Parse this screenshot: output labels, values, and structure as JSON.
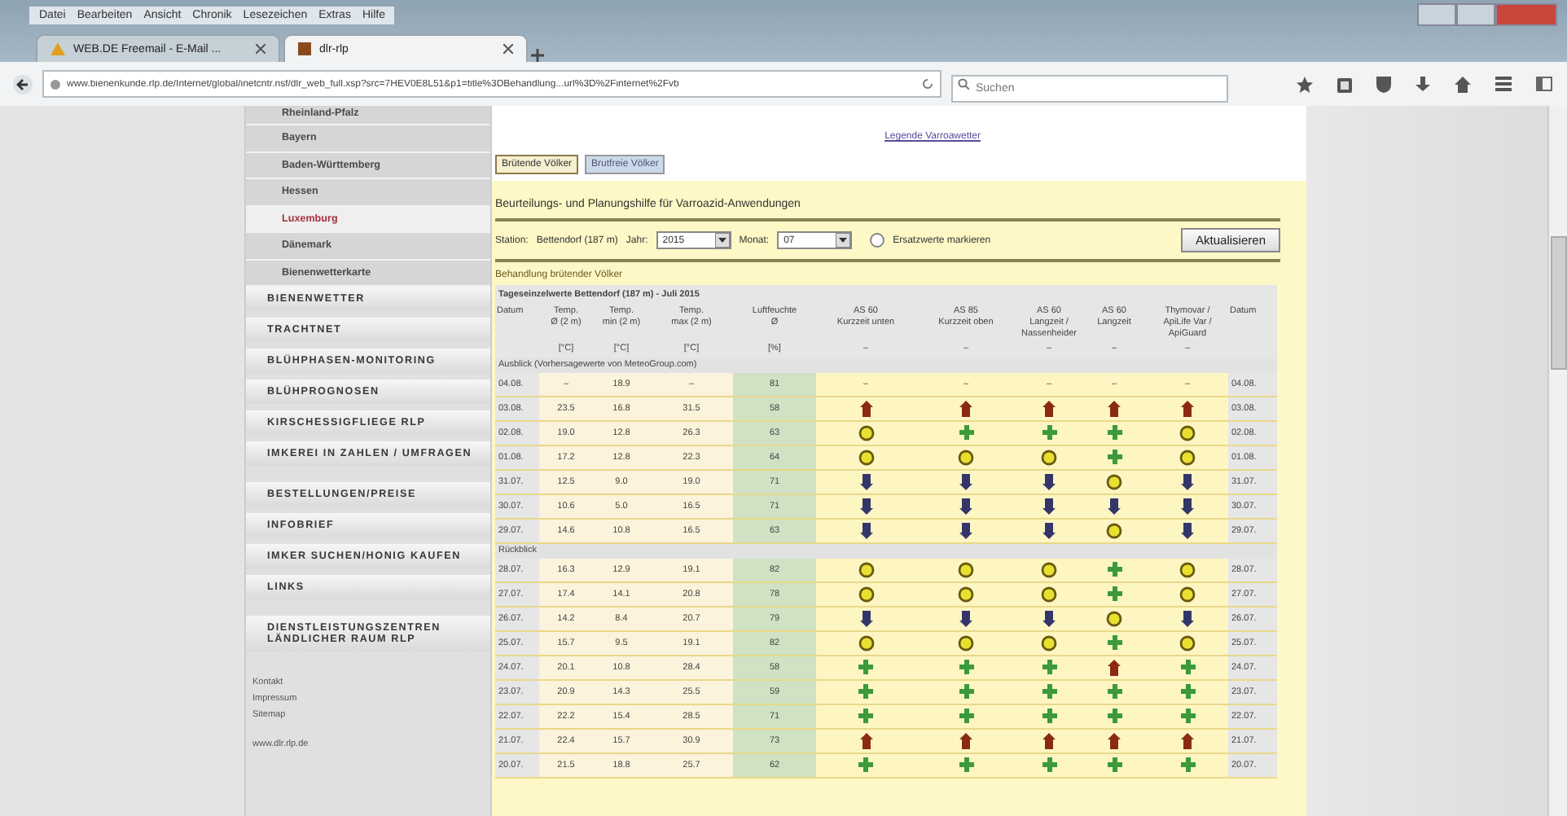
{
  "browser": {
    "menu": [
      "Datei",
      "Bearbeiten",
      "Ansicht",
      "Chronik",
      "Lesezeichen",
      "Extras",
      "Hilfe"
    ],
    "tabs": [
      {
        "label": "WEB.DE Freemail - E-Mail ...",
        "selected": false
      },
      {
        "label": "dlr-rlp",
        "selected": true
      }
    ],
    "address": "www.bienenkunde.rlp.de/Internet/global/inetcntr.nsf/dlr_web_full.xsp?src=7HEV0E8L51&p1=title%3DBehandlung...url%3D%2Finternet%2Fvb",
    "search": {
      "placeholder": "Suchen"
    }
  },
  "sidebar": {
    "sub_items": [
      {
        "label": "Rheinland-Pfalz",
        "selected": false
      },
      {
        "label": "Bayern",
        "selected": false
      },
      {
        "label": "Baden-Württemberg",
        "selected": false
      },
      {
        "label": "Hessen",
        "selected": false
      },
      {
        "label": "Luxemburg",
        "selected": true
      },
      {
        "label": "Dänemark",
        "selected": false
      },
      {
        "label": "Bienenwetterkarte",
        "selected": false
      }
    ],
    "items": [
      "BIENENWETTER",
      "TRACHTNET",
      "BLÜHPHASEN-MONITORING",
      "BLÜHPROGNOSEN",
      "KIRSCHESSIGFLIEGE RLP",
      "IMKEREI IN ZAHLEN / UMFRAGEN",
      "BESTELLUNGEN/PREISE",
      "INFOBRIEF",
      "IMKER SUCHEN/HONIG KAUFEN",
      "LINKS",
      "DIENSTLEISTUNGSZENTREN LÄNDLICHER RAUM RLP"
    ],
    "footer_links": [
      "Kontakt",
      "Impressum",
      "Sitemap"
    ],
    "website": "www.dlr.rlp.de"
  },
  "content": {
    "legend_link": "Legende Varroawetter",
    "tabs": [
      {
        "label": "Brütende Völker",
        "selected": true
      },
      {
        "label": "Brutfreie Völker",
        "selected": false
      }
    ],
    "title": "Beurteilungs- und Planungshilfe für Varroazid-Anwendungen",
    "form": {
      "station_label": "Station:",
      "station": "Bettendorf (187 m)",
      "year_label": "Jahr:",
      "year": "2015",
      "month_label": "Monat:",
      "month": "07",
      "option": {
        "label": "Ersatzwerte markieren",
        "checked": false
      },
      "button": "Aktualisieren"
    },
    "section_title": "Behandlung brütender Völker",
    "table": {
      "caption": "Tageseinzelwerte Bettendorf (187 m) - Juli 2015",
      "columns": [
        {
          "label": "Datum"
        },
        {
          "label": "Temp.\nØ (2 m)",
          "unit": "[°C]"
        },
        {
          "label": "Temp.\nmin (2 m)",
          "unit": "[°C]"
        },
        {
          "label": "Temp.\nmax (2 m)",
          "unit": "[°C]"
        },
        {
          "label": "Luftfeuchte\nØ",
          "unit": "[%]"
        },
        {
          "label": "AS 60\nKurzzeit unten",
          "unit": "–"
        },
        {
          "label": "AS 85\nKurzzeit oben",
          "unit": "–"
        },
        {
          "label": "AS 60\nLangzeit /\nNassenheider",
          "unit": "–"
        },
        {
          "label": "AS 60\nLangzeit",
          "unit": "–"
        },
        {
          "label": "Thymovar /\nApiLife Var /\nApiGuard",
          "unit": "–"
        },
        {
          "label": "Datum"
        }
      ],
      "groups": [
        {
          "title": "Ausblick (Vorhersagewerte von MeteoGroup.com)",
          "rows": [
            {
              "date": "04.08.",
              "values": [
                "–",
                "18.9",
                "–",
                "81"
              ],
              "ratings": [
                {
                  "kind": "text",
                  "text": "–"
                },
                {
                  "kind": "text",
                  "text": "–"
                },
                {
                  "kind": "text",
                  "text": "–"
                },
                {
                  "kind": "text",
                  "text": "–"
                },
                {
                  "kind": "text",
                  "text": "–"
                }
              ],
              "date_end": "04.08."
            },
            {
              "date": "03.08.",
              "values": [
                "23.5",
                "16.8",
                "31.5",
                "58"
              ],
              "ratings": [
                {
                  "kind": "hot"
                },
                {
                  "kind": "hot"
                },
                {
                  "kind": "hot"
                },
                {
                  "kind": "hot"
                },
                {
                  "kind": "hot"
                }
              ],
              "date_end": "03.08."
            },
            {
              "date": "02.08.",
              "values": [
                "19.0",
                "12.8",
                "26.3",
                "63"
              ],
              "ratings": [
                {
                  "kind": "fair"
                },
                {
                  "kind": "good"
                },
                {
                  "kind": "good"
                },
                {
                  "kind": "good"
                },
                {
                  "kind": "fair"
                }
              ],
              "date_end": "02.08."
            },
            {
              "date": "01.08.",
              "values": [
                "17.2",
                "12.8",
                "22.3",
                "64"
              ],
              "ratings": [
                {
                  "kind": "fair"
                },
                {
                  "kind": "fair"
                },
                {
                  "kind": "fair"
                },
                {
                  "kind": "good"
                },
                {
                  "kind": "fair"
                }
              ],
              "date_end": "01.08."
            },
            {
              "date": "31.07.",
              "values": [
                "12.5",
                "9.0",
                "19.0",
                "71"
              ],
              "ratings": [
                {
                  "kind": "cold"
                },
                {
                  "kind": "cold"
                },
                {
                  "kind": "cold"
                },
                {
                  "kind": "fair"
                },
                {
                  "kind": "cold"
                }
              ],
              "date_end": "31.07."
            },
            {
              "date": "30.07.",
              "values": [
                "10.6",
                "5.0",
                "16.5",
                "71"
              ],
              "ratings": [
                {
                  "kind": "cold"
                },
                {
                  "kind": "cold"
                },
                {
                  "kind": "cold"
                },
                {
                  "kind": "cold"
                },
                {
                  "kind": "cold"
                }
              ],
              "date_end": "30.07."
            },
            {
              "date": "29.07.",
              "values": [
                "14.6",
                "10.8",
                "16.5",
                "63"
              ],
              "ratings": [
                {
                  "kind": "cold"
                },
                {
                  "kind": "cold"
                },
                {
                  "kind": "cold"
                },
                {
                  "kind": "fair"
                },
                {
                  "kind": "cold"
                }
              ],
              "date_end": "29.07."
            }
          ]
        },
        {
          "title": "Rückblick",
          "rows": [
            {
              "date": "28.07.",
              "values": [
                "16.3",
                "12.9",
                "19.1",
                "82"
              ],
              "ratings": [
                {
                  "kind": "fair"
                },
                {
                  "kind": "fair"
                },
                {
                  "kind": "fair"
                },
                {
                  "kind": "good"
                },
                {
                  "kind": "fair"
                }
              ],
              "date_end": "28.07."
            },
            {
              "date": "27.07.",
              "values": [
                "17.4",
                "14.1",
                "20.8",
                "78"
              ],
              "ratings": [
                {
                  "kind": "fair"
                },
                {
                  "kind": "fair"
                },
                {
                  "kind": "fair"
                },
                {
                  "kind": "good"
                },
                {
                  "kind": "fair"
                }
              ],
              "date_end": "27.07."
            },
            {
              "date": "26.07.",
              "values": [
                "14.2",
                "8.4",
                "20.7",
                "79"
              ],
              "ratings": [
                {
                  "kind": "cold"
                },
                {
                  "kind": "cold"
                },
                {
                  "kind": "cold"
                },
                {
                  "kind": "fair"
                },
                {
                  "kind": "cold"
                }
              ],
              "date_end": "26.07."
            },
            {
              "date": "25.07.",
              "values": [
                "15.7",
                "9.5",
                "19.1",
                "82"
              ],
              "ratings": [
                {
                  "kind": "fair"
                },
                {
                  "kind": "fair"
                },
                {
                  "kind": "fair"
                },
                {
                  "kind": "good"
                },
                {
                  "kind": "fair"
                }
              ],
              "date_end": "25.07."
            },
            {
              "date": "24.07.",
              "values": [
                "20.1",
                "10.8",
                "28.4",
                "58"
              ],
              "ratings": [
                {
                  "kind": "good"
                },
                {
                  "kind": "good"
                },
                {
                  "kind": "good"
                },
                {
                  "kind": "hot"
                },
                {
                  "kind": "good"
                }
              ],
              "date_end": "24.07."
            },
            {
              "date": "23.07.",
              "values": [
                "20.9",
                "14.3",
                "25.5",
                "59"
              ],
              "ratings": [
                {
                  "kind": "good"
                },
                {
                  "kind": "good"
                },
                {
                  "kind": "good"
                },
                {
                  "kind": "good"
                },
                {
                  "kind": "good"
                }
              ],
              "date_end": "23.07."
            },
            {
              "date": "22.07.",
              "values": [
                "22.2",
                "15.4",
                "28.5",
                "71"
              ],
              "ratings": [
                {
                  "kind": "good"
                },
                {
                  "kind": "good"
                },
                {
                  "kind": "good"
                },
                {
                  "kind": "good"
                },
                {
                  "kind": "good"
                }
              ],
              "date_end": "22.07."
            },
            {
              "date": "21.07.",
              "values": [
                "22.4",
                "15.7",
                "30.9",
                "73"
              ],
              "ratings": [
                {
                  "kind": "hot"
                },
                {
                  "kind": "hot"
                },
                {
                  "kind": "hot"
                },
                {
                  "kind": "hot"
                },
                {
                  "kind": "hot"
                }
              ],
              "date_end": "21.07."
            },
            {
              "date": "20.07.",
              "values": [
                "21.5",
                "18.8",
                "25.7",
                "62"
              ],
              "ratings": [
                {
                  "kind": "good"
                },
                {
                  "kind": "good"
                },
                {
                  "kind": "good"
                },
                {
                  "kind": "good"
                },
                {
                  "kind": "good"
                }
              ],
              "date_end": "20.07."
            }
          ]
        }
      ]
    }
  }
}
